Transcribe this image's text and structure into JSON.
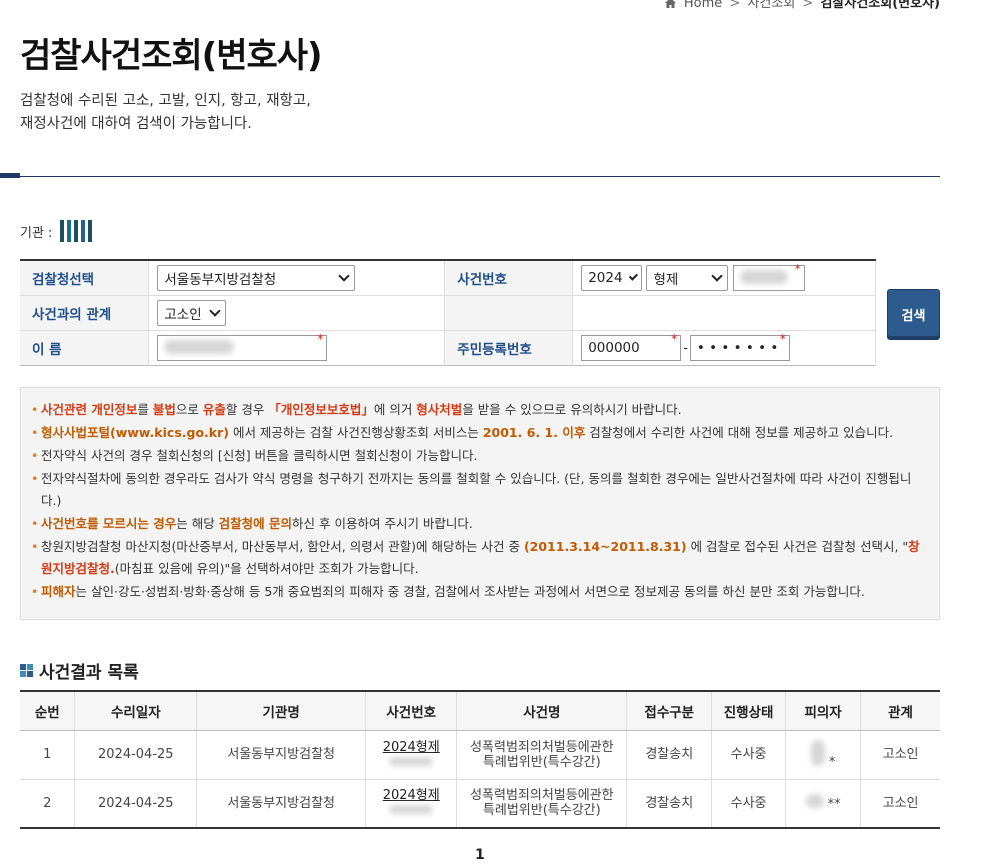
{
  "breadcrumb": {
    "home": "Home",
    "level1": "사건조회",
    "current": "검찰사건조회(변호사)",
    "separator": ">"
  },
  "page": {
    "title": "검찰사건조회(변호사)",
    "intro_line1": "검찰청에 수리된 고소, 고발, 인지, 항고, 재항고,",
    "intro_line2": "재정사건에 대하여 검색이 가능합니다."
  },
  "agency": {
    "label": "기관 :"
  },
  "search": {
    "office_label": "검찰청선택",
    "office_value": "서울동부지방검찰청",
    "case_no_label": "사건번호",
    "case_year": "2024",
    "case_type": "형제",
    "relation_label": "사건과의 관계",
    "relation_value": "고소인",
    "name_label": "이 름",
    "rrn_label": "주민등록번호",
    "rrn_front": "000000",
    "rrn_dash": "-",
    "rrn_back": "• • • • • • •",
    "required_mark": "*",
    "submit_label": "검색"
  },
  "notices": [
    {
      "parts": [
        [
          "사건관련 ",
          "red"
        ],
        [
          "개인정보",
          "red"
        ],
        [
          "를 ",
          ""
        ],
        [
          "불법",
          "red"
        ],
        [
          "으로 ",
          ""
        ],
        [
          "유출",
          "red"
        ],
        [
          "할 경우 ",
          ""
        ],
        [
          "「개인정보보호법」",
          "red"
        ],
        [
          "에 의거 ",
          ""
        ],
        [
          "형사처벌",
          "red"
        ],
        [
          "을 받을 수 있으므로 유의하시기 바랍니다.",
          ""
        ]
      ]
    },
    {
      "parts": [
        [
          "형사사법포털(www.kics.go.kr)",
          "orange"
        ],
        [
          " 에서 제공하는 검찰 사건진행상황조회 서비스는 ",
          ""
        ],
        [
          "2001. 6. 1. 이후",
          "orange"
        ],
        [
          " 검찰청에서 수리한 사건에 대해 정보를 제공하고 있습니다.",
          ""
        ]
      ]
    },
    {
      "parts": [
        [
          "전자약식 사건의 경우 철회신청의 [신청] 버튼을 클릭하시면 철회신청이 가능합니다.",
          ""
        ]
      ]
    },
    {
      "parts": [
        [
          "전자약식절차에 동의한 경우라도 검사가 약식 명령을 청구하기 전까지는 동의를 철회할 수 있습니다. (단, 동의를 철회한 경우에는 일반사건절차에 따라 사건이 진행됩니다.)",
          ""
        ]
      ]
    },
    {
      "parts": [
        [
          "사건번호를 모르시는 경우",
          "orange"
        ],
        [
          "는 해당 ",
          ""
        ],
        [
          "검찰청에 문의",
          "orange"
        ],
        [
          "하신 후 이용하여 주시기 바랍니다.",
          ""
        ]
      ]
    },
    {
      "parts": [
        [
          "창원지방검찰청 마산지청(마산중부서, 마산동부서, 함안서, 의령서 관할)에 해당하는 사건 중 ",
          ""
        ],
        [
          "(2011.3.14~2011.8.31)",
          "orange"
        ],
        [
          " 에 검찰로 접수된 사건은 검찰청 선택시, \"",
          ""
        ],
        [
          "창원지방검찰청.",
          "red"
        ],
        [
          "(마침표 있음에 유의)\"을 선택하셔야만 조회가 가능합니다.",
          ""
        ]
      ]
    },
    {
      "parts": [
        [
          "피해자",
          "orange"
        ],
        [
          "는 살인·강도·성범죄·방화·중상해 등 5개 중요범죄의 피해자 중 경찰, 검찰에서 조사받는 과정에서 서면으로 정보제공 동의를 하신 분만 조회 가능합니다.",
          ""
        ]
      ]
    }
  ],
  "results": {
    "title": "사건결과 목록",
    "columns": [
      "순번",
      "수리일자",
      "기관명",
      "사건번호",
      "사건명",
      "접수구분",
      "진행상태",
      "피의자",
      "관계"
    ],
    "rows": [
      {
        "no": "1",
        "date": "2024-04-25",
        "agency": "서울동부지방검찰청",
        "case_no": "2024형제",
        "case_name_1": "성폭력범죄의처벌등에관한",
        "case_name_2": "특례법위반(특수강간)",
        "intake": "경찰송치",
        "status": "수사중",
        "suspect": "*",
        "relation": "고소인"
      },
      {
        "no": "2",
        "date": "2024-04-25",
        "agency": "서울동부지방검찰청",
        "case_no": "2024형제",
        "case_name_1": "성폭력범죄의처벌등에관한",
        "case_name_2": "특례법위반(특수강간)",
        "intake": "경찰송치",
        "status": "수사중",
        "suspect": "**",
        "relation": "고소인"
      }
    ]
  },
  "pagination": {
    "current_page": "1"
  },
  "colors": {
    "primary": "#2e5b8e",
    "label_blue": "#1f4e8c",
    "highlight_red": "#d43b14",
    "highlight_orange": "#c25a00",
    "required": "#e0201a"
  }
}
